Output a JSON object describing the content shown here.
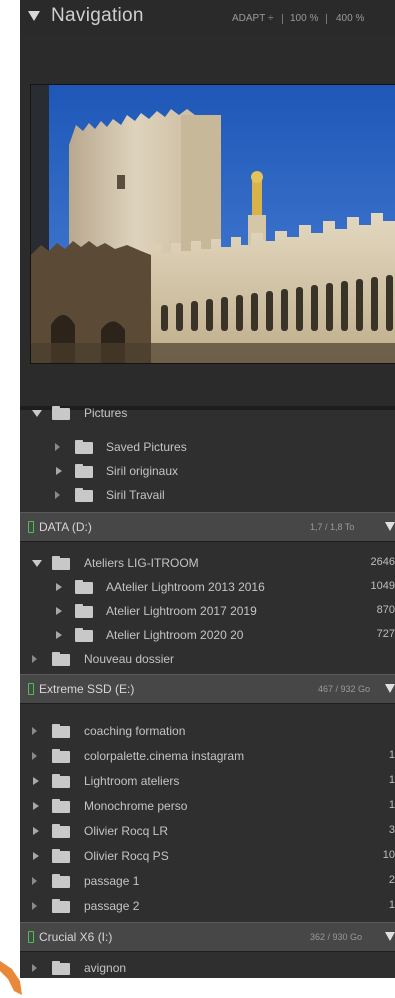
{
  "navigator": {
    "title": "Navigation",
    "options": [
      "ADAPT ÷",
      "100 %",
      "400 %"
    ]
  },
  "folders_top": [
    {
      "label": "Pictures",
      "depth": 1,
      "state": "expanded"
    },
    {
      "label": "Saved Pictures",
      "depth": 2,
      "state": "collapsed"
    },
    {
      "label": "Siril originaux",
      "depth": 2,
      "state": "collapsed"
    },
    {
      "label": "Siril Travail",
      "depth": 2,
      "state": "collapsed"
    }
  ],
  "volumes": [
    {
      "name": "DATA (D:)",
      "size": "1,7 / 1,8 To",
      "folders": [
        {
          "label": "Ateliers LIG-ITROOM",
          "depth": 1,
          "state": "expanded",
          "count": "2646"
        },
        {
          "label": "AAtelier Lightroom 2013 2016",
          "depth": 2,
          "state": "collapsed",
          "count": "1049"
        },
        {
          "label": "Atelier Lightroom 2017 2019",
          "depth": 2,
          "state": "collapsed",
          "count": "870"
        },
        {
          "label": "Atelier Lightroom 2020 20",
          "depth": 2,
          "state": "collapsed",
          "count": "727"
        },
        {
          "label": "Nouveau dossier",
          "depth": 1,
          "state": "collapsed",
          "count": ""
        }
      ]
    },
    {
      "name": "Extreme SSD (E:)",
      "size": "467 / 932 Go",
      "folders": [
        {
          "label": "coaching formation",
          "depth": 1,
          "state": "collapsed",
          "count": ""
        },
        {
          "label": "colorpalette.cinema instagram",
          "depth": 1,
          "state": "collapsed",
          "count": "1"
        },
        {
          "label": "Lightroom ateliers",
          "depth": 1,
          "state": "collapsed",
          "count": "1"
        },
        {
          "label": "Monochrome perso",
          "depth": 1,
          "state": "collapsed",
          "count": "1"
        },
        {
          "label": "Olivier Rocq LR",
          "depth": 1,
          "state": "collapsed",
          "count": "3"
        },
        {
          "label": "Olivier Rocq PS",
          "depth": 1,
          "state": "collapsed",
          "count": "10"
        },
        {
          "label": "passage 1",
          "depth": 1,
          "state": "collapsed",
          "count": "2"
        },
        {
          "label": "passage 2",
          "depth": 1,
          "state": "collapsed",
          "count": "1"
        }
      ]
    },
    {
      "name": "Crucial X6 (I:)",
      "size": "362 / 930 Go",
      "folders": [
        {
          "label": "avignon",
          "depth": 1,
          "state": "collapsed",
          "count": ""
        }
      ]
    }
  ],
  "colors": {
    "panel_bg": "#2f2f2f",
    "volume_header_bg": "#474747",
    "volume_led": "#4fbf4f",
    "text": "#c4c4c4",
    "annotation_arrow": "#e8893a"
  }
}
